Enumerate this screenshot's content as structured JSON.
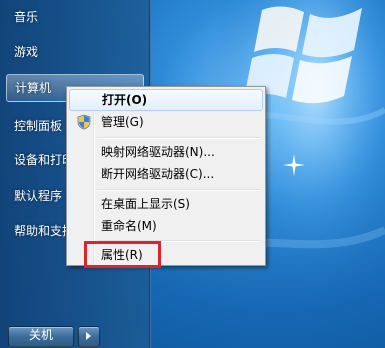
{
  "start_menu": {
    "items": [
      {
        "label": "音乐"
      },
      {
        "label": "游戏"
      },
      {
        "label": "计算机"
      },
      {
        "label": "控制面板"
      },
      {
        "label": "设备和打印机"
      },
      {
        "label": "默认程序"
      },
      {
        "label": "帮助和支持"
      }
    ],
    "shutdown_label": "关机"
  },
  "context_menu": {
    "items": [
      {
        "label": "打开(O)"
      },
      {
        "label": "管理(G)"
      },
      {
        "label": "映射网络驱动器(N)..."
      },
      {
        "label": "断开网络驱动器(C)..."
      },
      {
        "label": "在桌面上显示(S)"
      },
      {
        "label": "重命名(M)"
      },
      {
        "label": "属性(R)"
      }
    ]
  },
  "colors": {
    "highlight_box": "#d8262a",
    "menu_background": "#f0f0f0"
  },
  "icons": [
    "shield-icon",
    "windows-logo-icon",
    "shutdown-arrow-icon"
  ]
}
